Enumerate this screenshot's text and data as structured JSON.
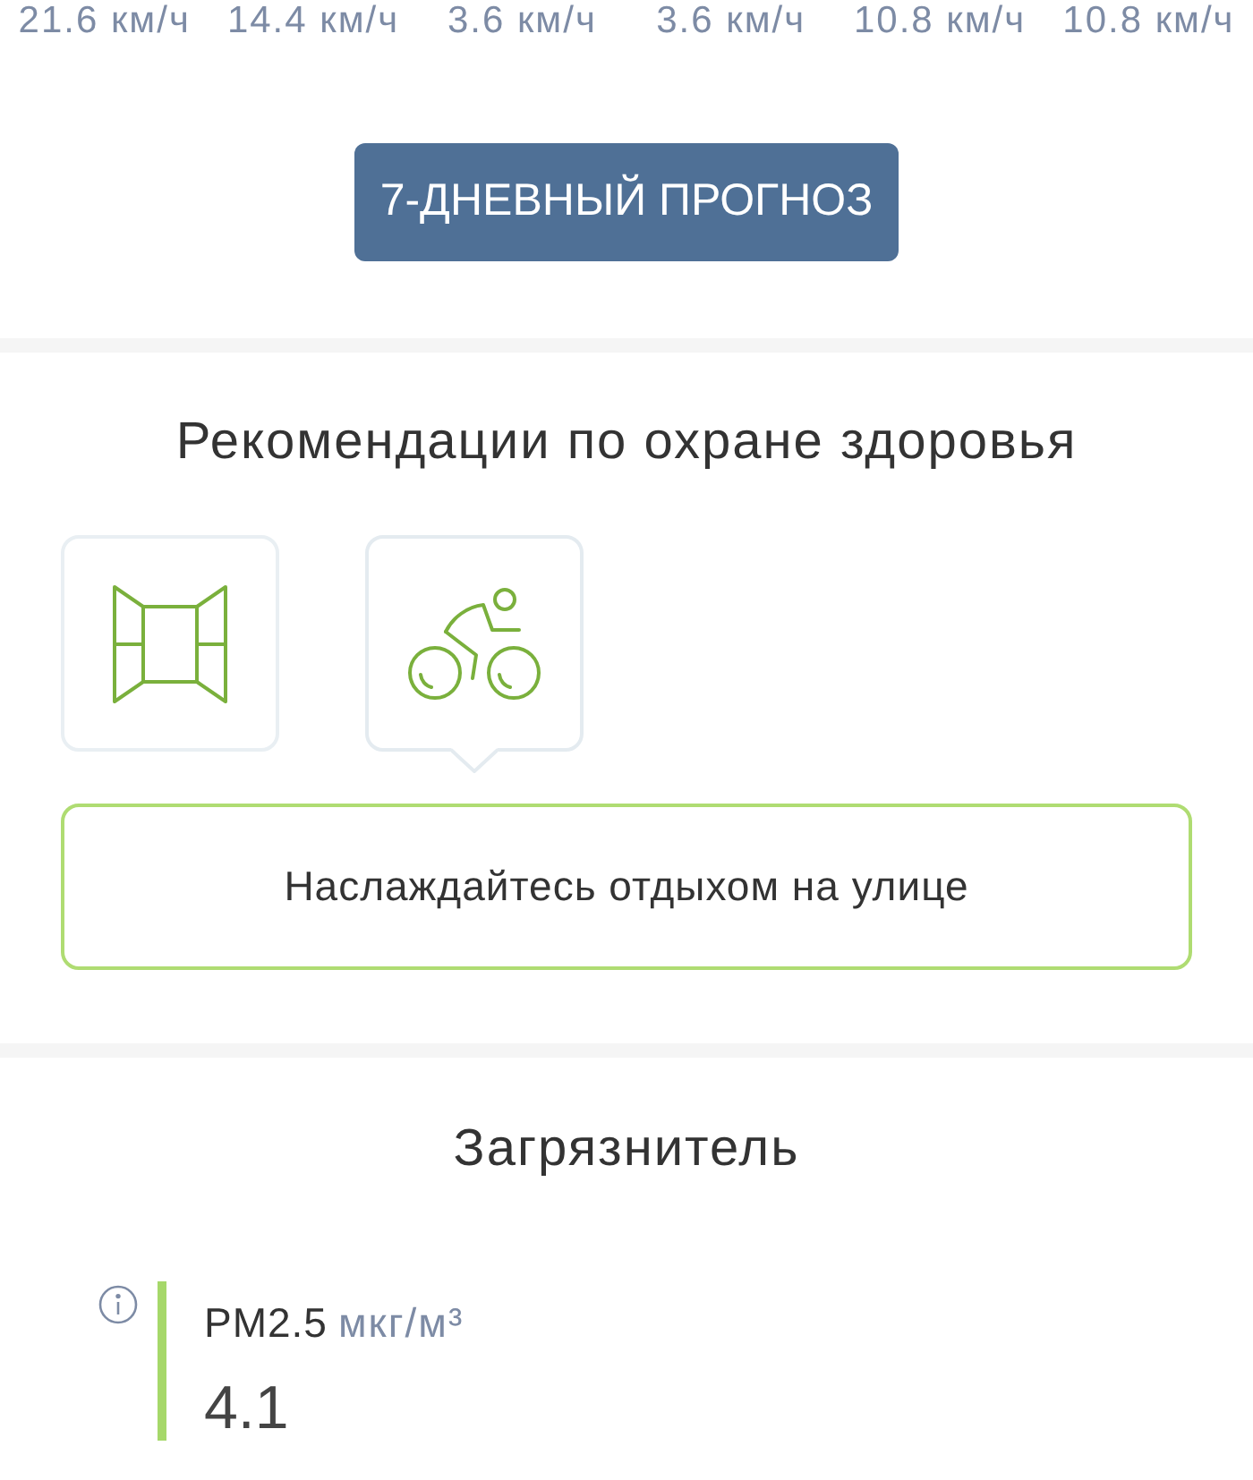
{
  "wind_speeds": [
    "21.6 км/ч",
    "14.4 км/ч",
    "3.6 км/ч",
    "3.6 км/ч",
    "10.8 км/ч",
    "10.8 км/ч"
  ],
  "forecast_button": {
    "label": "7-ДНЕВНЫЙ ПРОГНОЗ"
  },
  "health": {
    "title": "Рекомендации по охране здоровья",
    "activities": [
      {
        "kind": "window",
        "selected": false
      },
      {
        "kind": "cycling",
        "selected": true
      }
    ],
    "advice": "Наслаждайтесь отдыхом на улице"
  },
  "pollutants": {
    "title": "Загрязнитель",
    "items": [
      {
        "name": "PM2.5",
        "unit": "мкг/м³",
        "value": "4.1",
        "color": "#a6d86a"
      }
    ]
  }
}
